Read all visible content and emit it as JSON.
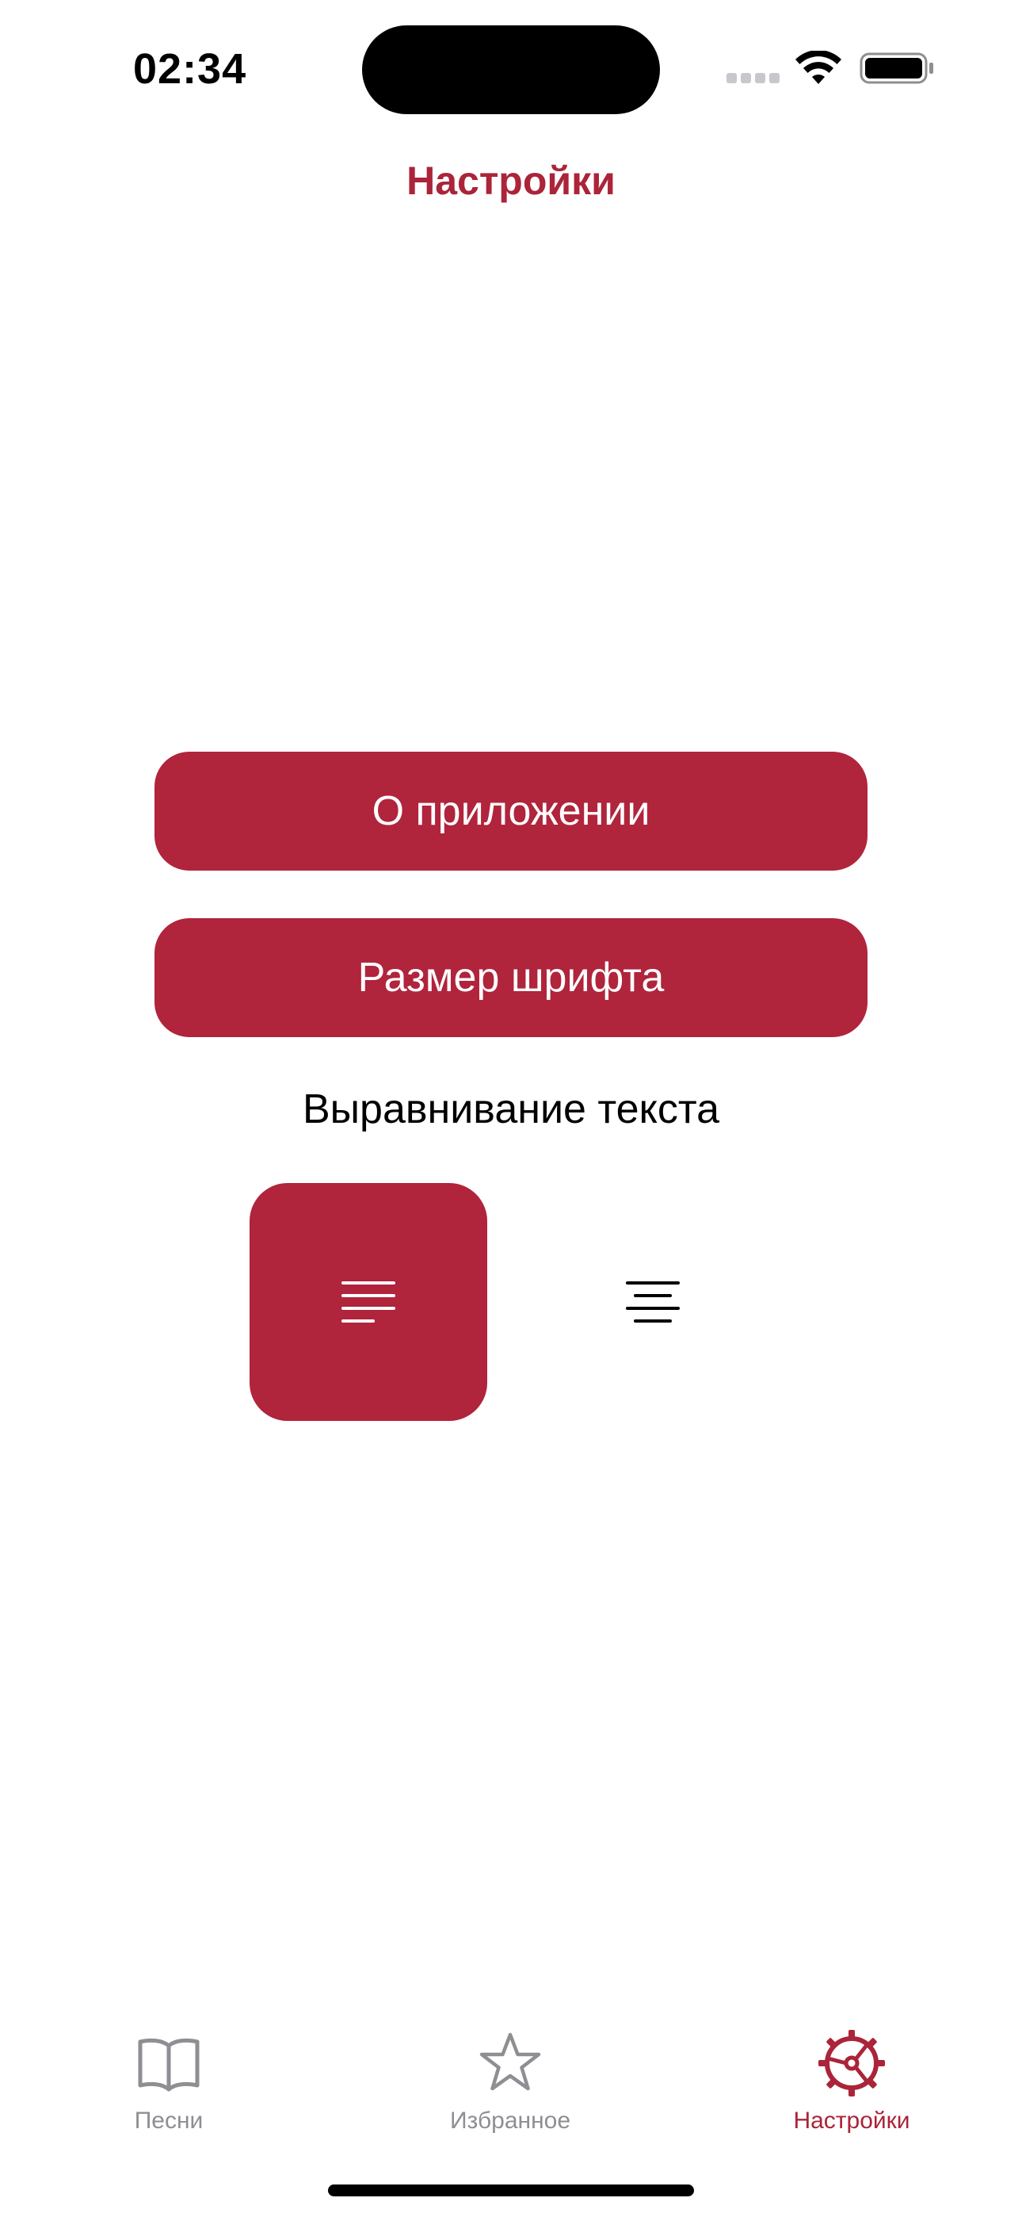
{
  "status_bar": {
    "time": "02:34"
  },
  "nav": {
    "title": "Настройки"
  },
  "buttons": {
    "about": "О приложении",
    "font_size": "Размер шрифта"
  },
  "alignment": {
    "label": "Выравнивание текста",
    "selected": "left",
    "options": [
      "left",
      "center"
    ]
  },
  "tab_bar": {
    "items": [
      {
        "label": "Песни",
        "icon": "book-icon",
        "active": false
      },
      {
        "label": "Избранное",
        "icon": "star-icon",
        "active": false
      },
      {
        "label": "Настройки",
        "icon": "steering-wheel-icon",
        "active": true
      }
    ]
  },
  "colors": {
    "accent": "#b0243c",
    "title": "#ab2439",
    "inactive": "#8e8e93",
    "background": "#ffffff"
  }
}
